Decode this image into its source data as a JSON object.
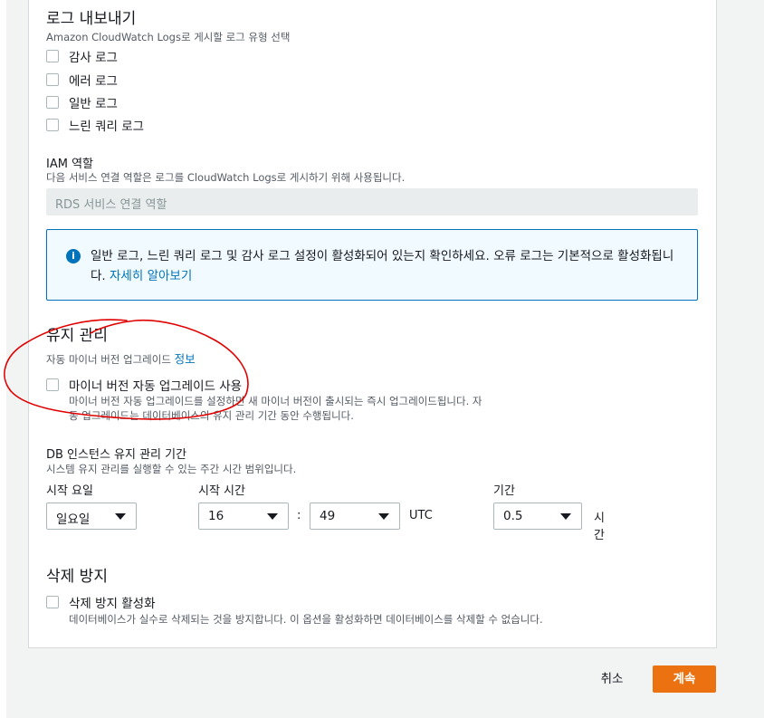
{
  "log_export": {
    "title": "로그 내보내기",
    "description": "Amazon CloudWatch Logs로 게시할 로그 유형 선택",
    "options": [
      {
        "label": "감사 로그",
        "checked": false
      },
      {
        "label": "에러 로그",
        "checked": false
      },
      {
        "label": "일반 로그",
        "checked": false
      },
      {
        "label": "느린 쿼리 로그",
        "checked": false
      }
    ]
  },
  "iam_role": {
    "title": "IAM 역할",
    "description": "다음 서비스 연결 역할은 로그를 CloudWatch Logs로 게시하기 위해 사용됩니다.",
    "value": "RDS 서비스 연결 역할"
  },
  "info_box": {
    "text": "일반 로그, 느린 쿼리 로그 및 감사 로그 설정이 활성화되어 있는지 확인하세요. 오류 로그는 기본적으로 활성화됩니다.",
    "link": "자세히 알아보기",
    "icon": "info-icon"
  },
  "maintenance": {
    "title": "유지 관리",
    "subtitle": "자동 마이너 버전 업그레이드",
    "info_link": "정보",
    "checkbox_label": "마이너 버전 자동 업그레이드 사용",
    "checkbox_desc_line1": "마이너 버전 자동 업그레이드를 설정하면 새 마이너 버전이 출시되는 즉시 업그레이드됩니다. 자",
    "checkbox_desc_line2": "동 업그레이드는 데이터베이스의 유지 관리 기간 동안 수행됩니다.",
    "checked": false
  },
  "maintenance_window": {
    "title": "DB 인스턴스 유지 관리 기간",
    "description": "시스템 유지 관리를 실행할 수 있는 주간 시간 범위입니다.",
    "start_day_label": "시작 요일",
    "start_day_value": "일요일",
    "start_time_label": "시작 시간",
    "hour_value": "16",
    "separator": ":",
    "minute_value": "49",
    "timezone": "UTC",
    "duration_label": "기간",
    "duration_value": "0.5",
    "duration_unit_line1": "시",
    "duration_unit_line2": "간"
  },
  "deletion_protection": {
    "title": "삭제 방지",
    "checkbox_label": "삭제 방지 활성화",
    "checkbox_desc": "데이터베이스가 실수로 삭제되는 것을 방지합니다. 이 옵션을 활성화하면 데이터베이스를 삭제할 수 없습니다.",
    "checked": false
  },
  "footer": {
    "cancel_label": "취소",
    "continue_label": "계속"
  },
  "colors": {
    "accent": "#ec7211",
    "link": "#0073bb",
    "annotation": "#e00000"
  }
}
